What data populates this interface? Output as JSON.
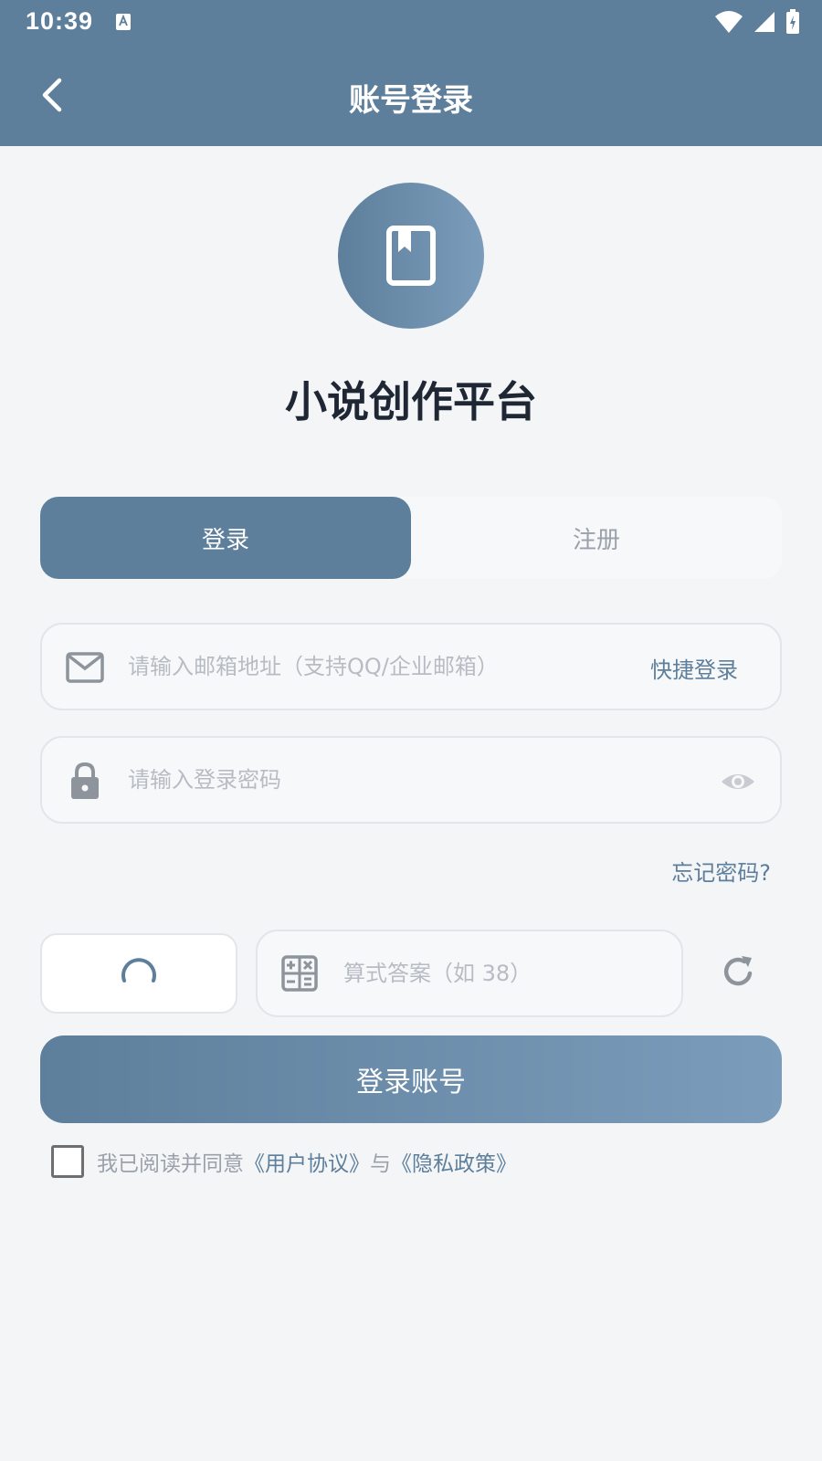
{
  "status_bar": {
    "time": "10:39"
  },
  "header": {
    "title": "账号登录"
  },
  "app": {
    "name": "小说创作平台"
  },
  "tabs": [
    {
      "label": "登录",
      "active": true
    },
    {
      "label": "注册",
      "active": false
    }
  ],
  "email": {
    "placeholder": "请输入邮箱地址（支持QQ/企业邮箱）",
    "value": "",
    "quick_login": "快捷登录"
  },
  "password": {
    "placeholder": "请输入登录密码",
    "value": ""
  },
  "forgot_password": "忘记密码?",
  "captcha": {
    "placeholder": "算式答案（如 38）",
    "value": ""
  },
  "login_button": "登录账号",
  "agreement": {
    "prefix": "我已阅读并同意",
    "user_agreement": "《用户协议》",
    "conjunction": "与",
    "privacy_policy": "《隐私政策》",
    "checked": false
  },
  "icons": [
    "back-icon",
    "book-icon",
    "mail-icon",
    "lock-icon",
    "eye-icon",
    "calculator-icon",
    "loading-spinner-icon",
    "refresh-icon",
    "wifi-icon",
    "signal-icon",
    "battery-icon",
    "keyboard-notification-icon"
  ],
  "colors": {
    "primary": "#5d7f9c",
    "primary_light": "#7b9dbb",
    "background": "#f4f5f7",
    "title": "#1e2733",
    "placeholder": "#b7bcc4"
  }
}
